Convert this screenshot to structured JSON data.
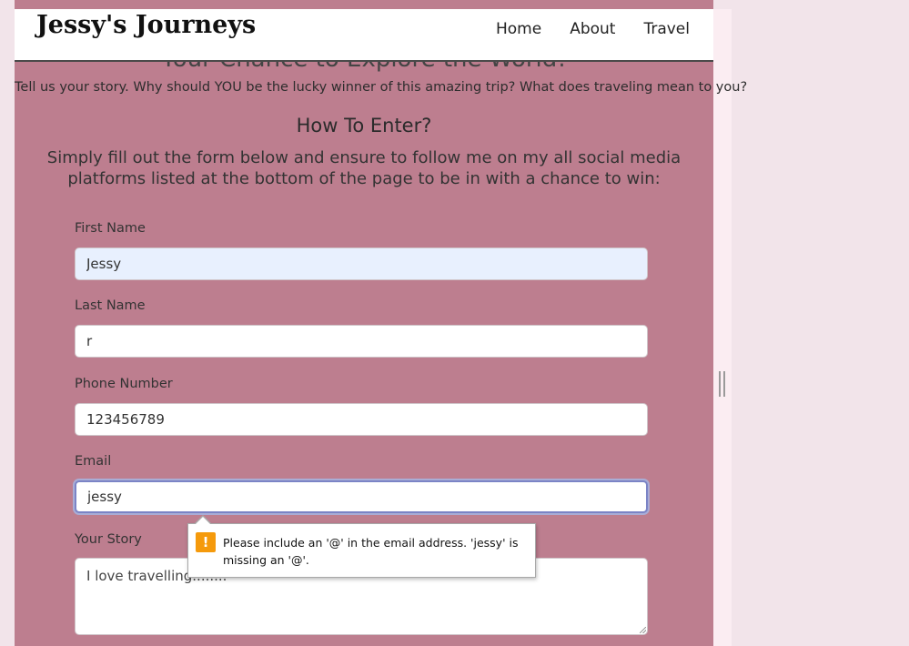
{
  "header": {
    "brand": "Jessy's Journeys",
    "nav": [
      "Home",
      "About",
      "Travel"
    ]
  },
  "content": {
    "partial_heading": "Your Chance to Explore the World!",
    "intro": "Tell us your story. Why should YOU be the lucky winner of this amazing trip? What does traveling mean to you?",
    "how_title": "How To Enter?",
    "how_text": "Simply fill out the form below and ensure to follow me on my all social media platforms listed at the bottom of the page to be in with a chance to win:"
  },
  "form": {
    "first_name": {
      "label": "First Name",
      "value": "Jessy"
    },
    "last_name": {
      "label": "Last Name",
      "value": "r"
    },
    "phone": {
      "label": "Phone Number",
      "value": "123456789"
    },
    "email": {
      "label": "Email",
      "value": "jessy"
    },
    "story": {
      "label": "Your Story",
      "value": "I love travelling........"
    }
  },
  "validation": {
    "message": "Please include an '@' in the email address. 'jessy' is missing an '@'.",
    "icon": "warning-icon",
    "icon_color": "#f59a0c"
  },
  "colors": {
    "page_bg": "#f2e4ea",
    "content_bg": "#bd7e8f",
    "focus_ring": "#7b84c6"
  }
}
